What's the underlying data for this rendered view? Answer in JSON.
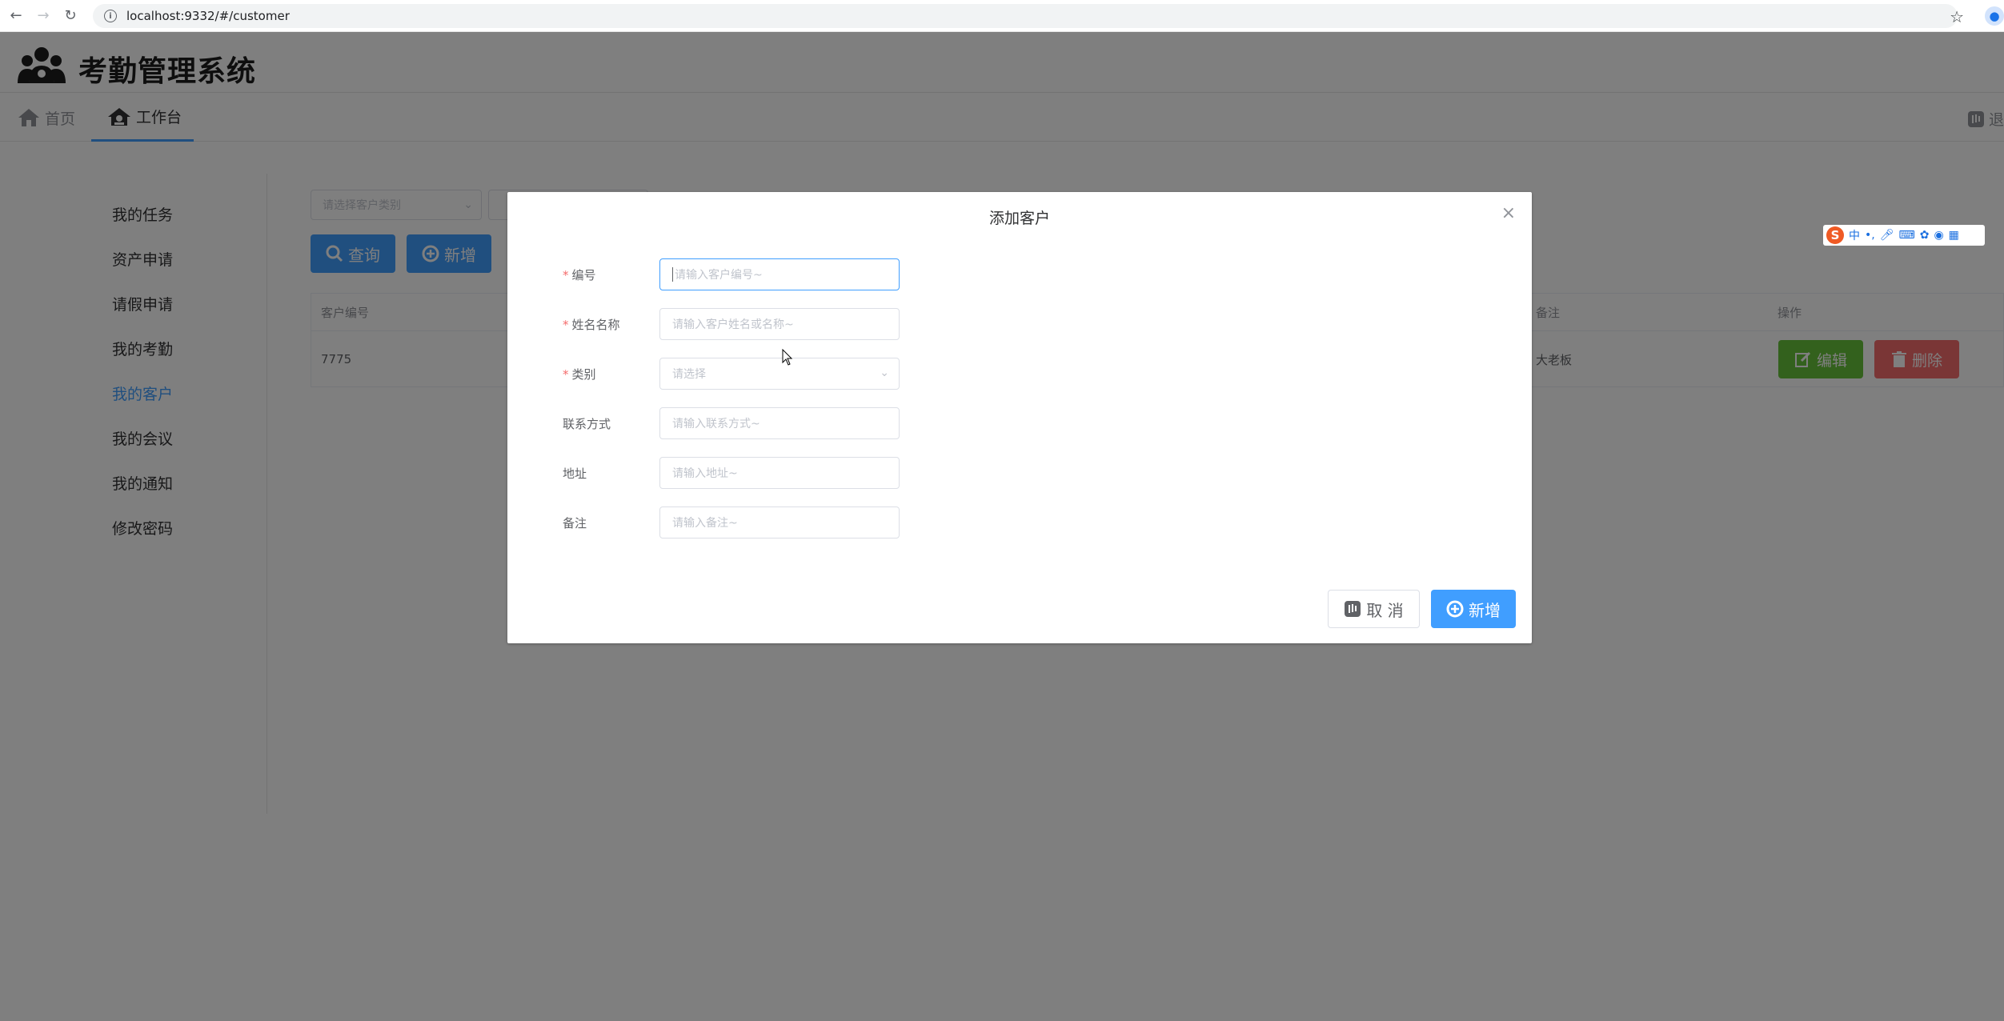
{
  "browser": {
    "url": "localhost:9332/#/customer"
  },
  "app": {
    "title": "考勤管理系统",
    "nav": {
      "home": "首页",
      "workbench": "工作台",
      "right_partial": "退"
    },
    "sidebar": {
      "items": [
        {
          "label": "我的任务"
        },
        {
          "label": "资产申请"
        },
        {
          "label": "请假申请"
        },
        {
          "label": "我的考勤"
        },
        {
          "label": "我的客户"
        },
        {
          "label": "我的会议"
        },
        {
          "label": "我的通知"
        },
        {
          "label": "修改密码"
        }
      ],
      "active": "我的客户"
    },
    "filter": {
      "category_placeholder": "请选择客户类别"
    },
    "toolbar": {
      "query_label": "查询",
      "add_label": "新增"
    },
    "table": {
      "headers": [
        "客户编号",
        "备注",
        "操作"
      ],
      "rows": [
        {
          "code": "7775",
          "note": "大老板"
        }
      ],
      "edit_label": "编辑",
      "delete_label": "删除"
    }
  },
  "ime": {
    "logo": "S",
    "mode": "中"
  },
  "dialog": {
    "title": "添加客户",
    "fields": [
      {
        "label": "编号",
        "required": true,
        "placeholder": "请输入客户编号~"
      },
      {
        "label": "姓名名称",
        "required": true,
        "placeholder": "请输入客户姓名或名称~"
      },
      {
        "label": "类别",
        "required": true,
        "placeholder": "请选择"
      },
      {
        "label": "联系方式",
        "required": false,
        "placeholder": "请输入联系方式~"
      },
      {
        "label": "地址",
        "required": false,
        "placeholder": "请输入地址~"
      },
      {
        "label": "备注",
        "required": false,
        "placeholder": "请输入备注~"
      }
    ],
    "cancel_label": "取 消",
    "submit_label": "新增"
  },
  "colors": {
    "primary": "#409eff",
    "success": "#67c23a",
    "danger": "#f56c6c",
    "overlay": "rgba(0,0,0,0.5)"
  }
}
